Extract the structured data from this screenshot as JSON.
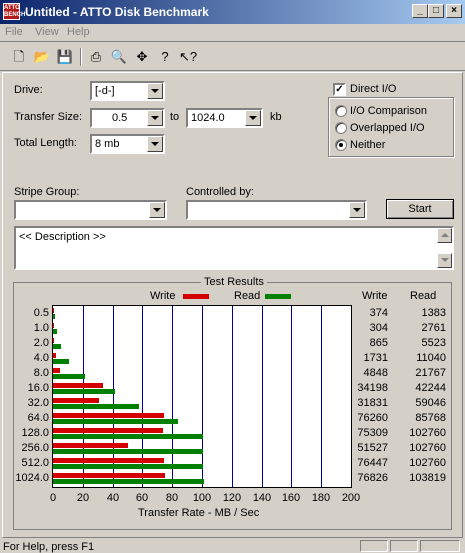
{
  "window": {
    "title": "Untitled - ATTO Disk Benchmark",
    "icon_text": "ATTO BENCH"
  },
  "menu": [
    "File",
    "View",
    "Help"
  ],
  "toolbar_icons": [
    "new-icon",
    "open-icon",
    "save-icon",
    "print-icon",
    "print-preview-icon",
    "move-icon",
    "help-icon",
    "context-help-icon"
  ],
  "form": {
    "drive_label": "Drive:",
    "drive_value": "[-d-]",
    "transfer_size_label": "Transfer Size:",
    "transfer_from": "0.5",
    "transfer_to_label": "to",
    "transfer_to": "1024.0",
    "transfer_unit": "kb",
    "total_length_label": "Total Length:",
    "total_length_value": "8 mb",
    "direct_io_label": "Direct I/O",
    "direct_io_checked": true,
    "io_modes": [
      {
        "label": "I/O Comparison",
        "selected": false
      },
      {
        "label": "Overlapped I/O",
        "selected": false
      },
      {
        "label": "Neither",
        "selected": true
      }
    ],
    "stripe_group_label": "Stripe Group:",
    "controlled_by_label": "Controlled by:",
    "start_label": "Start",
    "description": "<< Description >>"
  },
  "results": {
    "title": "Test Results",
    "legend_write": "Write",
    "legend_read": "Read",
    "col_write": "Write",
    "col_read": "Read",
    "write_color": "#d40000",
    "read_color": "#008000",
    "rows": [
      {
        "size": "0.5",
        "write": "374",
        "read": "1383"
      },
      {
        "size": "1.0",
        "write": "304",
        "read": "2761"
      },
      {
        "size": "2.0",
        "write": "865",
        "read": "5523"
      },
      {
        "size": "4.0",
        "write": "1731",
        "read": "11040"
      },
      {
        "size": "8.0",
        "write": "4848",
        "read": "21767"
      },
      {
        "size": "16.0",
        "write": "34198",
        "read": "42244"
      },
      {
        "size": "32.0",
        "write": "31831",
        "read": "59046"
      },
      {
        "size": "64.0",
        "write": "76260",
        "read": "85768"
      },
      {
        "size": "128.0",
        "write": "75309",
        "read": "102760"
      },
      {
        "size": "256.0",
        "write": "51527",
        "read": "102760"
      },
      {
        "size": "512.0",
        "write": "76447",
        "read": "102760"
      },
      {
        "size": "1024.0",
        "write": "76826",
        "read": "103819"
      }
    ]
  },
  "chart_data": {
    "type": "bar",
    "orientation": "horizontal",
    "title": "Test Results",
    "xlabel": "Transfer Rate - MB / Sec",
    "xlim": [
      0,
      200
    ],
    "xticks": [
      "0",
      "20",
      "40",
      "60",
      "80",
      "100",
      "120",
      "140",
      "160",
      "180",
      "200"
    ],
    "categories": [
      "0.5",
      "1.0",
      "2.0",
      "4.0",
      "8.0",
      "16.0",
      "32.0",
      "64.0",
      "128.0",
      "256.0",
      "512.0",
      "1024.0"
    ],
    "series": [
      {
        "name": "Write",
        "values": [
          0.37,
          0.3,
          0.84,
          1.69,
          4.73,
          33.4,
          31.1,
          74.5,
          73.5,
          50.3,
          74.7,
          75.0
        ]
      },
      {
        "name": "Read",
        "values": [
          1.35,
          2.7,
          5.39,
          10.8,
          21.3,
          41.3,
          57.7,
          83.8,
          100.4,
          100.4,
          100.4,
          101.4
        ]
      }
    ],
    "legend_position": "top"
  },
  "status": {
    "text": "For Help, press F1"
  }
}
